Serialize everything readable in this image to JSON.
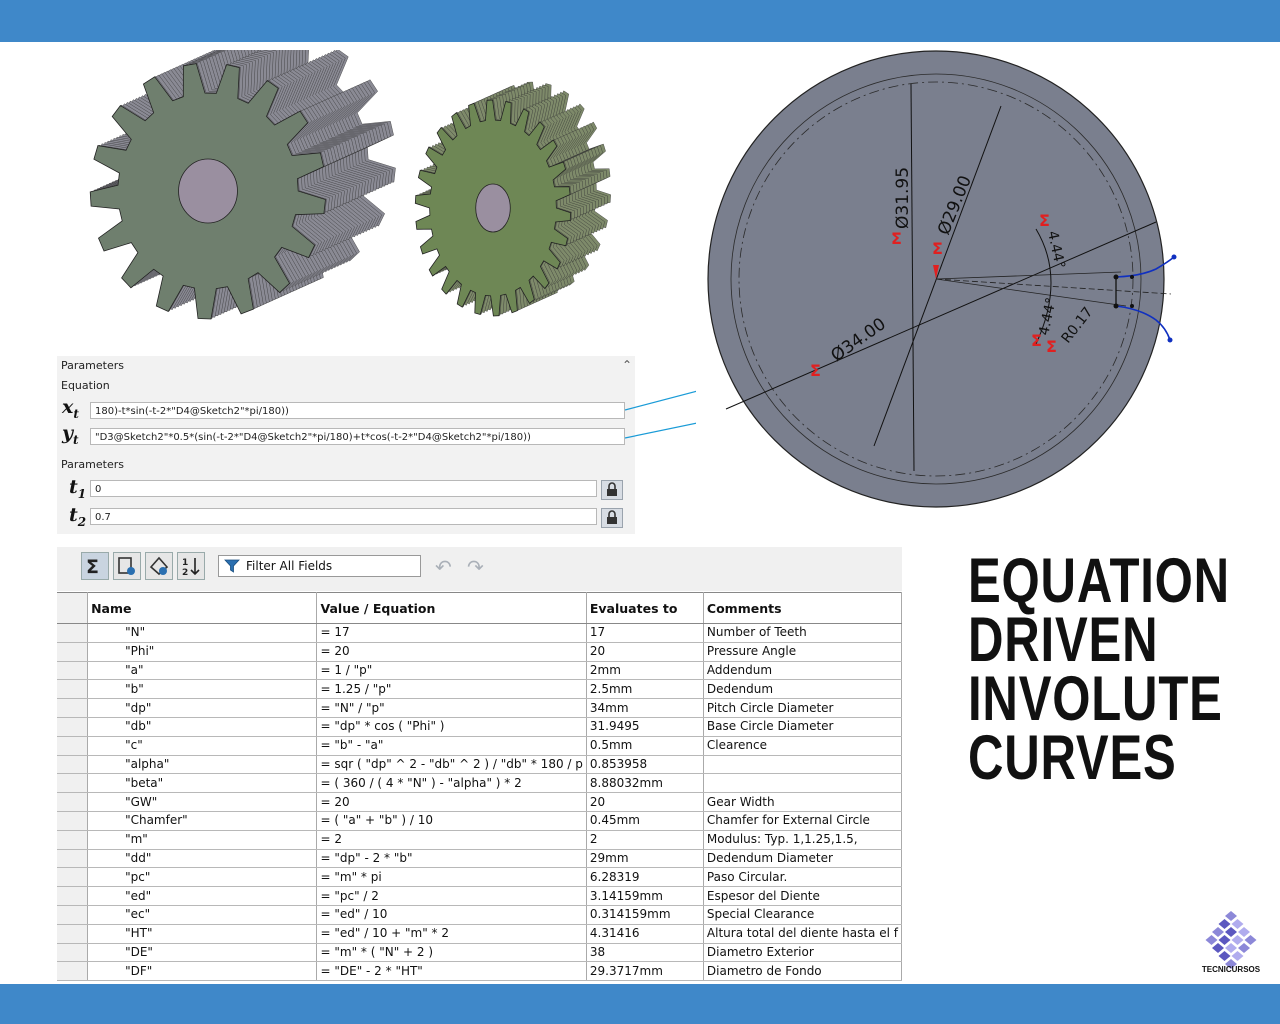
{
  "colors": {
    "banner": "#3f88c9",
    "gear_steel": "#6f7f6e",
    "gear_green": "#6e8755",
    "sketch_disc": "#7a7f8e",
    "callout": "#1a9bd7",
    "dim_red": "#e02020"
  },
  "params_panel": {
    "header": "Parameters",
    "equation_label": "Equation",
    "xt_symbol": "x",
    "xt_sub": "t",
    "xt_value": "180)-t*sin(-t-2*\"D4@Sketch2\"*pi/180))",
    "yt_symbol": "y",
    "yt_sub": "t",
    "yt_value": "\"D3@Sketch2\"*0.5*(sin(-t-2*\"D4@Sketch2\"*pi/180)+t*cos(-t-2*\"D4@Sketch2\"*pi/180))",
    "parameters_label": "Parameters",
    "t1_symbol": "t",
    "t1_sub": "1",
    "t1_value": "0",
    "t2_symbol": "t",
    "t2_sub": "2",
    "t2_value": "0.7"
  },
  "drawing": {
    "dim_base_circle": "Ø31.95",
    "dim_dedendum": "Ø29.00",
    "dim_pitch": "Ø34.00",
    "dim_angle_top": "4.44°",
    "dim_angle_bottom": "4.44°",
    "dim_radius": "R0.17",
    "equation_marker": "Σ"
  },
  "equations": {
    "toolbar": {
      "filter_placeholder": "Filter All Fields"
    },
    "columns": [
      "Name",
      "Value / Equation",
      "Evaluates to",
      "Comments"
    ],
    "rows": [
      {
        "name": "\"N\"",
        "value": "= 17",
        "eval": "17",
        "comment": "Number of Teeth"
      },
      {
        "name": "\"Phi\"",
        "value": "= 20",
        "eval": "20",
        "comment": "Pressure Angle"
      },
      {
        "name": "\"a\"",
        "value": "= 1 / \"p\"",
        "eval": "2mm",
        "comment": "Addendum"
      },
      {
        "name": "\"b\"",
        "value": "= 1.25 / \"p\"",
        "eval": "2.5mm",
        "comment": "Dedendum"
      },
      {
        "name": "\"dp\"",
        "value": "= \"N\" / \"p\"",
        "eval": "34mm",
        "comment": "Pitch Circle Diameter"
      },
      {
        "name": "\"db\"",
        "value": "= \"dp\" * cos ( \"Phi\" )",
        "eval": "31.9495",
        "comment": "Base Circle Diameter"
      },
      {
        "name": "\"c\"",
        "value": "= \"b\" - \"a\"",
        "eval": "0.5mm",
        "comment": "Clearence"
      },
      {
        "name": "\"alpha\"",
        "value": "= sqr ( \"dp\" ^ 2 - \"db\" ^ 2 ) / \"db\" * 180 / p",
        "eval": "0.853958",
        "comment": ""
      },
      {
        "name": "\"beta\"",
        "value": "= ( 360 / ( 4 * \"N\" ) - \"alpha\" ) * 2",
        "eval": "8.88032mm",
        "comment": ""
      },
      {
        "name": "\"GW\"",
        "value": "= 20",
        "eval": "20",
        "comment": "Gear Width"
      },
      {
        "name": "\"Chamfer\"",
        "value": "= ( \"a\" + \"b\" ) / 10",
        "eval": "0.45mm",
        "comment": "Chamfer for External Circle"
      },
      {
        "name": "\"m\"",
        "value": "= 2",
        "eval": "2",
        "comment": "Modulus: Typ. 1,1.25,1.5,"
      },
      {
        "name": "\"dd\"",
        "value": "= \"dp\" - 2 * \"b\"",
        "eval": "29mm",
        "comment": "Dedendum Diameter"
      },
      {
        "name": "\"pc\"",
        "value": "= \"m\" * pi",
        "eval": "6.28319",
        "comment": "Paso Circular."
      },
      {
        "name": "\"ed\"",
        "value": "= \"pc\" / 2",
        "eval": "3.14159mm",
        "comment": "Espesor del Diente"
      },
      {
        "name": "\"ec\"",
        "value": "= \"ed\" / 10",
        "eval": "0.314159mm",
        "comment": "Special Clearance"
      },
      {
        "name": "\"HT\"",
        "value": "= \"ed\" / 10 + \"m\" * 2",
        "eval": "4.31416",
        "comment": "Altura total del diente hasta el f"
      },
      {
        "name": "\"DE\"",
        "value": "= \"m\" * ( \"N\" + 2 )",
        "eval": "38",
        "comment": "Diametro Exterior"
      },
      {
        "name": "\"DF\"",
        "value": "= \"DE\" - 2 * \"HT\"",
        "eval": "29.3717mm",
        "comment": "Diametro de Fondo"
      }
    ]
  },
  "title": {
    "line1": "EQUATION",
    "line2": "DRIVEN",
    "line3": "INVOLUTE",
    "line4": "CURVES"
  },
  "logo": {
    "text": "TECNICURSOS"
  }
}
